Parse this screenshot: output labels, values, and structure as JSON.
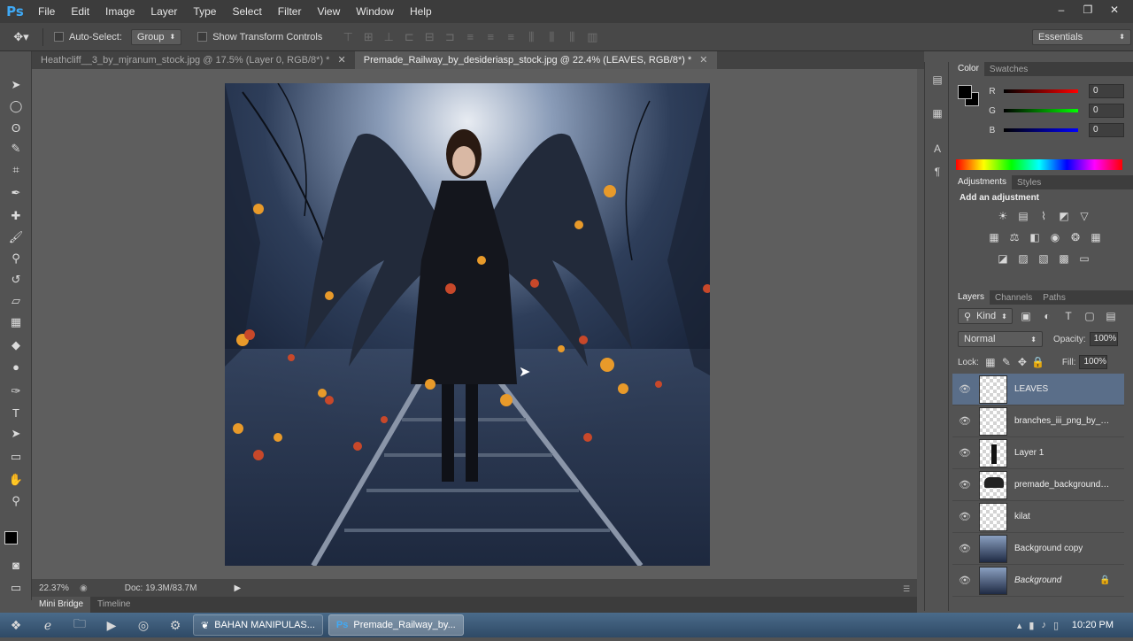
{
  "app": {
    "logo": "Ps",
    "menu": [
      "File",
      "Edit",
      "Image",
      "Layer",
      "Type",
      "Select",
      "Filter",
      "View",
      "Window",
      "Help"
    ],
    "window_controls": [
      "–",
      "❐",
      "✕"
    ]
  },
  "options": {
    "auto_select_label": "Auto-Select:",
    "auto_select_mode": "Group",
    "transform_label": "Show Transform Controls",
    "workspace": "Essentials"
  },
  "document_tabs": [
    {
      "label": "Heathcliff__3_by_mjranum_stock.jpg @ 17.5% (Layer 0, RGB/8*) *",
      "active": false
    },
    {
      "label": "Premade_Railway_by_desideriasp_stock.jpg @ 22.4% (LEAVES, RGB/8*) *",
      "active": true
    }
  ],
  "status": {
    "zoom": "22.37%",
    "doc": "Doc: 19.3M/83.7M"
  },
  "bottom_tabs": [
    "Mini Bridge",
    "Timeline"
  ],
  "color_panel": {
    "tabs": [
      "Color",
      "Swatches"
    ],
    "channels": [
      {
        "letter": "R",
        "value": "0",
        "color": "#d43b3b"
      },
      {
        "letter": "G",
        "value": "0",
        "color": "#3bb43b"
      },
      {
        "letter": "B",
        "value": "0",
        "color": "#3b6bd4"
      }
    ]
  },
  "adjustments_panel": {
    "tabs": [
      "Adjustments",
      "Styles"
    ],
    "heading": "Add an adjustment"
  },
  "layers_panel": {
    "tabs": [
      "Layers",
      "Channels",
      "Paths"
    ],
    "kind_label": "Kind",
    "blend_mode": "Normal",
    "opacity_label": "Opacity:",
    "opacity_value": "100%",
    "lock_label": "Lock:",
    "fill_label": "Fill:",
    "fill_value": "100%",
    "layers": [
      {
        "name": "LEAVES",
        "selected": true,
        "thumb": "transparent"
      },
      {
        "name": "branches_iii_png_by_si...",
        "selected": false,
        "thumb": "transparent"
      },
      {
        "name": "Layer 1",
        "selected": false,
        "thumb": "figure"
      },
      {
        "name": "premade_background_...",
        "selected": false,
        "thumb": "wings"
      },
      {
        "name": "kilat",
        "selected": false,
        "thumb": "transparent"
      },
      {
        "name": "Background copy",
        "selected": false,
        "thumb": "photo"
      },
      {
        "name": "Background",
        "selected": false,
        "thumb": "photo",
        "italic": true,
        "locked": true
      }
    ]
  },
  "taskbar": {
    "buttons": [
      {
        "label": "BAHAN MANIPULAS...",
        "active": false
      },
      {
        "label": "Premade_Railway_by...",
        "active": true
      }
    ],
    "clock": "10:20 PM"
  }
}
